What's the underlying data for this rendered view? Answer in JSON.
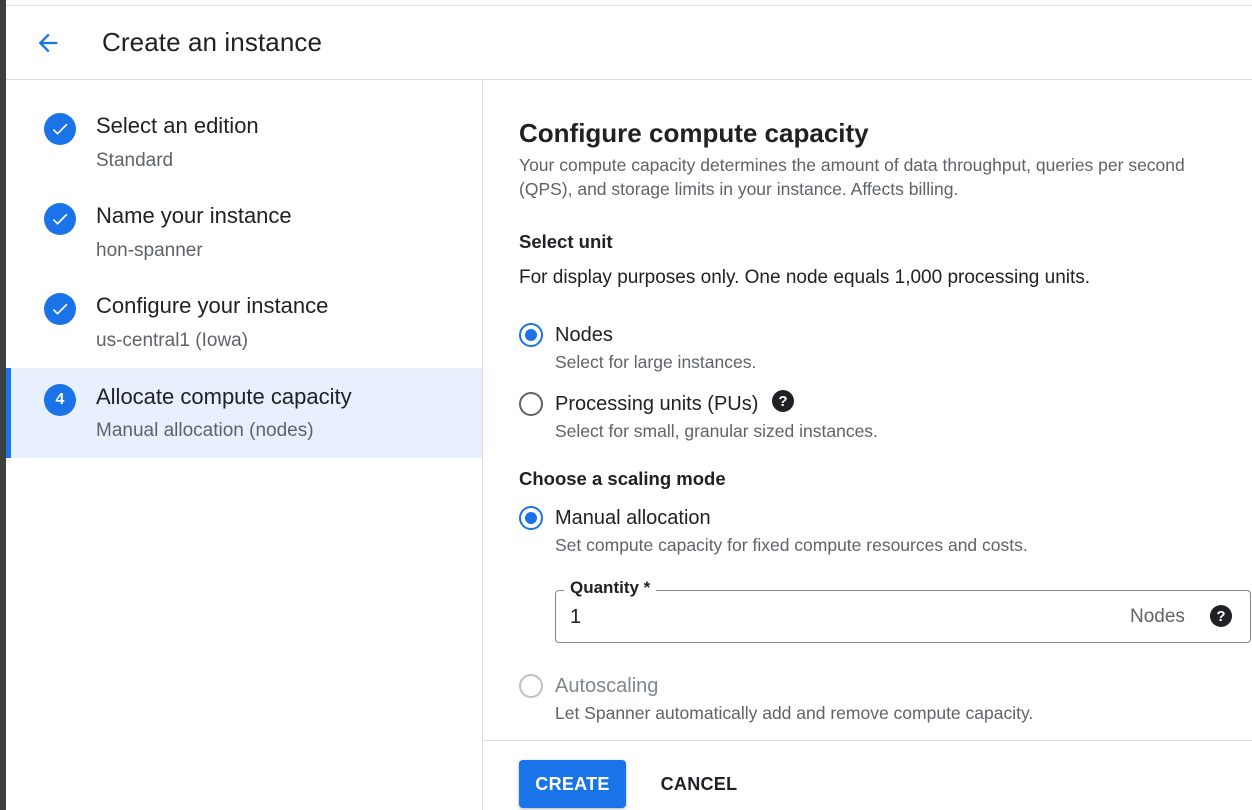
{
  "header": {
    "title": "Create an instance",
    "back_icon": "arrow-back-icon"
  },
  "colors": {
    "accent": "#1a73e8",
    "active_step_bg": "#e8f0fe",
    "text_primary": "#202124",
    "text_secondary": "#5f6368"
  },
  "steps": [
    {
      "title": "Select an edition",
      "subtitle": "Standard",
      "state": "complete",
      "icon": "check-circle-icon"
    },
    {
      "title": "Name your instance",
      "subtitle": "hon-spanner",
      "state": "complete",
      "icon": "check-circle-icon"
    },
    {
      "title": "Configure your instance",
      "subtitle": "us-central1 (Iowa)",
      "state": "complete",
      "icon": "check-circle-icon"
    },
    {
      "title": "Allocate compute capacity",
      "subtitle": "Manual allocation (nodes)",
      "state": "active",
      "number": "4"
    }
  ],
  "main": {
    "title": "Configure compute capacity",
    "description": "Your compute capacity determines the amount of data throughput, queries per second (QPS), and storage limits in your instance. Affects billing.",
    "select_unit": {
      "title": "Select unit",
      "note": "For display purposes only. One node equals 1,000 processing units.",
      "options": [
        {
          "label": "Nodes",
          "help": "Select for large instances.",
          "checked": true
        },
        {
          "label": "Processing units (PUs)",
          "help": "Select for small, granular sized instances.",
          "checked": false
        }
      ]
    },
    "scaling": {
      "title": "Choose a scaling mode",
      "options": [
        {
          "label": "Manual allocation",
          "help": "Set compute capacity for fixed compute resources and costs.",
          "checked": true,
          "disabled": false
        },
        {
          "label": "Autoscaling",
          "help": "Let Spanner automatically add and remove compute capacity.",
          "checked": false,
          "disabled": true
        }
      ]
    },
    "quantity": {
      "label": "Quantity *",
      "value": "1",
      "suffix": "Nodes"
    }
  },
  "footer": {
    "create_label": "CREATE",
    "cancel_label": "CANCEL"
  }
}
